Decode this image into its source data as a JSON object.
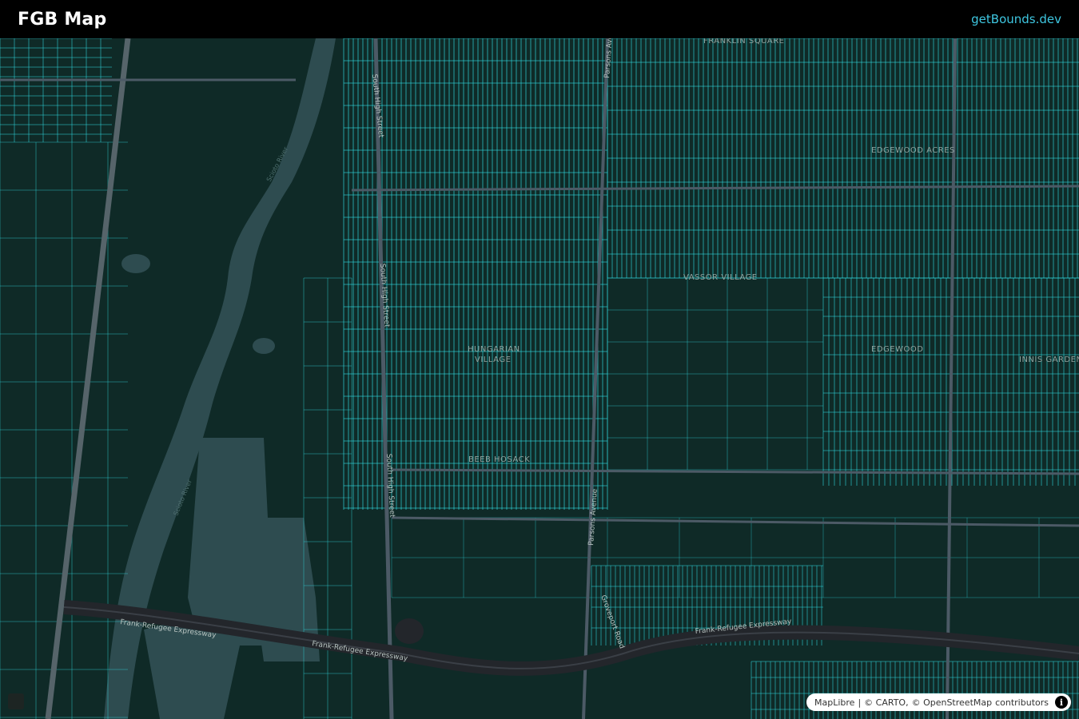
{
  "header": {
    "title": "FGB Map",
    "link_text": "getBounds.dev"
  },
  "map": {
    "neighborhoods": [
      "FRANKLIN SQUARE",
      "EDGEWOOD ACRES",
      "VASSOR VILLAGE",
      "EDGEWOOD",
      "HUNGARIAN",
      "VILLAGE",
      "BEEB HOSACK",
      "INNIS GARDEN"
    ],
    "roads": [
      "South High Street",
      "South High Street",
      "South High Street",
      "Parsons Avenue",
      "Parsons Avenue",
      "Frank-Refugee Expressway",
      "Frank-Refugee Expressway",
      "Frank-Refugee Expressway",
      "Groveport Road"
    ],
    "rivers": [
      "Scioto River",
      "Scioto River"
    ],
    "colors": {
      "background": "#0f2a27",
      "parcel_line": "#2fd6dd",
      "road": "#4c5a66",
      "highway": "#2a2d33",
      "water": "#2e4c50"
    }
  },
  "attribution": {
    "maplibre": "MapLibre",
    "sep": "|",
    "carto": "© CARTO,",
    "osm": "© OpenStreetMap",
    "contributors": "contributors",
    "info_icon": "info-icon"
  }
}
